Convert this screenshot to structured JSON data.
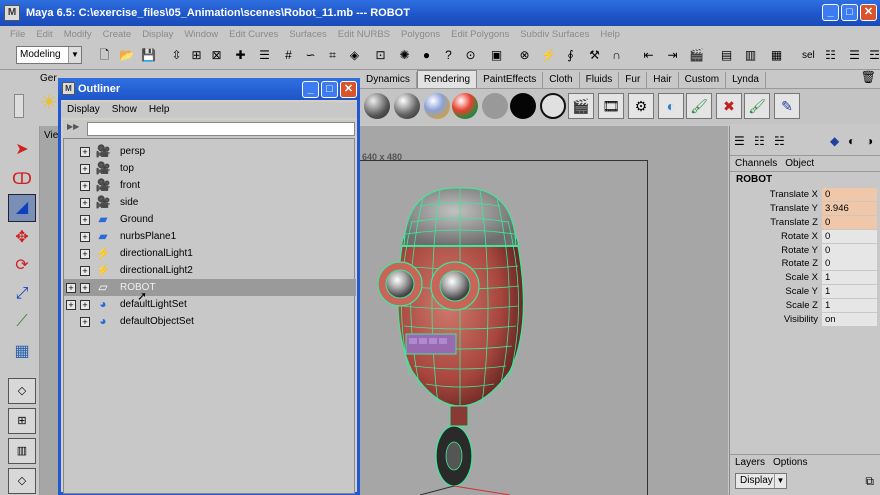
{
  "window": {
    "title": "Maya 6.5: C:\\exercise_files\\05_Animation\\scenes\\Robot_11.mb  ---  ROBOT"
  },
  "menubar": [
    "File",
    "Edit",
    "Modify",
    "Create",
    "Display",
    "Window",
    "Edit Curves",
    "Surfaces",
    "Edit NURBS",
    "Polygons",
    "Edit Polygons",
    "Subdiv Surfaces",
    "Help"
  ],
  "statusline": {
    "mode": "Modeling",
    "selection_label": "sel"
  },
  "shelf": {
    "partial_tab": "Ger",
    "tabs": [
      "Dynamics",
      "Rendering",
      "PaintEffects",
      "Cloth",
      "Fluids",
      "Fur",
      "Hair",
      "Custom",
      "Lynda"
    ],
    "active_tab": "Rendering"
  },
  "viewport": {
    "menu_fragment": "Vie",
    "resolution": "640 x 480"
  },
  "outliner": {
    "title": "Outliner",
    "menus": [
      "Display",
      "Show",
      "Help"
    ],
    "items": [
      {
        "label": "persp",
        "icon": "camera-icon",
        "selected": false,
        "has_children_toggle": false
      },
      {
        "label": "top",
        "icon": "camera-icon",
        "selected": false,
        "has_children_toggle": false
      },
      {
        "label": "front",
        "icon": "camera-icon",
        "selected": false,
        "has_children_toggle": false
      },
      {
        "label": "side",
        "icon": "camera-icon",
        "selected": false,
        "has_children_toggle": false
      },
      {
        "label": "Ground",
        "icon": "nurbs-plane-icon",
        "selected": false,
        "has_children_toggle": false
      },
      {
        "label": "nurbsPlane1",
        "icon": "nurbs-plane-icon",
        "selected": false,
        "has_children_toggle": false
      },
      {
        "label": "directionalLight1",
        "icon": "directional-light-icon",
        "selected": false,
        "has_children_toggle": false
      },
      {
        "label": "directionalLight2",
        "icon": "directional-light-icon",
        "selected": false,
        "has_children_toggle": false
      },
      {
        "label": "ROBOT",
        "icon": "group-icon",
        "selected": true,
        "has_children_toggle": true
      },
      {
        "label": "defaultLightSet",
        "icon": "set-icon",
        "selected": false,
        "has_children_toggle": true
      },
      {
        "label": "defaultObjectSet",
        "icon": "set-icon",
        "selected": false,
        "has_children_toggle": false
      }
    ]
  },
  "channel_box": {
    "menus": [
      "Channels",
      "Object"
    ],
    "object_name": "ROBOT",
    "attributes": [
      {
        "label": "Translate X",
        "value": "0",
        "keyed": true
      },
      {
        "label": "Translate Y",
        "value": "3.946",
        "keyed": true
      },
      {
        "label": "Translate Z",
        "value": "0",
        "keyed": true
      },
      {
        "label": "Rotate X",
        "value": "0",
        "keyed": false
      },
      {
        "label": "Rotate Y",
        "value": "0",
        "keyed": false
      },
      {
        "label": "Rotate Z",
        "value": "0",
        "keyed": false
      },
      {
        "label": "Scale X",
        "value": "1",
        "keyed": false
      },
      {
        "label": "Scale Y",
        "value": "1",
        "keyed": false
      },
      {
        "label": "Scale Z",
        "value": "1",
        "keyed": false
      },
      {
        "label": "Visibility",
        "value": "on",
        "keyed": false
      }
    ],
    "layers_menus": [
      "Layers",
      "Options"
    ],
    "layer_display": "Display"
  },
  "colors": {
    "titlebar": "#1e55c8",
    "robot_body": "#b35a50",
    "wireframe": "#3ee89a",
    "keyed_channel": "#f0c7a8"
  }
}
